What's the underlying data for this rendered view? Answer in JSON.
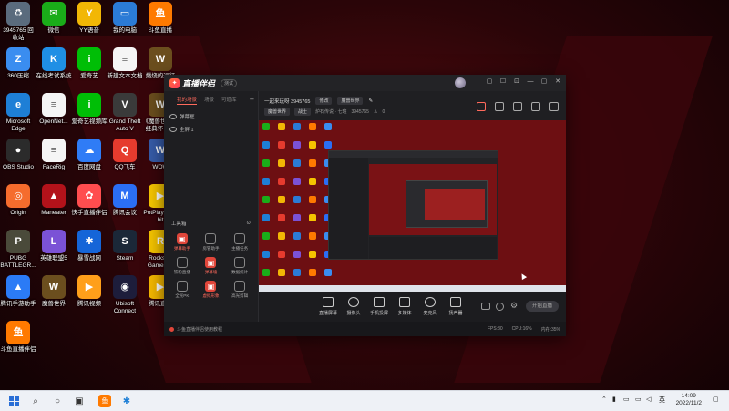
{
  "desktop": {
    "icons": [
      {
        "label": "3945765 回收站",
        "glyph": "♻",
        "color": "#5a6b7d"
      },
      {
        "label": "微信",
        "glyph": "✉",
        "color": "#1aad19"
      },
      {
        "label": "YY语音",
        "glyph": "Y",
        "color": "#f2b705"
      },
      {
        "label": "我的电脑",
        "glyph": "▭",
        "color": "#2b7bd6"
      },
      {
        "label": "斗鱼直播",
        "glyph": "鱼",
        "color": "#ff7a00"
      },
      {
        "label": "360压缩",
        "glyph": "Z",
        "color": "#3a8df0"
      },
      {
        "label": "在线考试系统",
        "glyph": "K",
        "color": "#1f8fe5"
      },
      {
        "label": "爱奇艺",
        "glyph": "i",
        "color": "#00be06"
      },
      {
        "label": "新建文本文档",
        "glyph": "≡",
        "color": "#f5f5f5"
      },
      {
        "label": "燃烧的远征",
        "glyph": "W",
        "color": "#6b4e1e"
      },
      {
        "label": "Microsoft Edge",
        "glyph": "e",
        "color": "#1e7fd6"
      },
      {
        "label": "OpenNet...",
        "glyph": "≡",
        "color": "#f5f5f5"
      },
      {
        "label": "爱奇艺视频库",
        "glyph": "i",
        "color": "#00be06"
      },
      {
        "label": "Grand Theft Auto V",
        "glyph": "V",
        "color": "#3a3a3a"
      },
      {
        "label": "《魔兽世界》经典怀旧服",
        "glyph": "W",
        "color": "#6b4e1e"
      },
      {
        "label": "OBS Studio",
        "glyph": "●",
        "color": "#2b2b2b"
      },
      {
        "label": "FaceRig",
        "glyph": "≡",
        "color": "#f5f5f5"
      },
      {
        "label": "百度网盘",
        "glyph": "☁",
        "color": "#2f7cf6"
      },
      {
        "label": "QQ飞车",
        "glyph": "Q",
        "color": "#e63b2e"
      },
      {
        "label": "WOW",
        "glyph": "W",
        "color": "#365ba8"
      },
      {
        "label": "Origin",
        "glyph": "◎",
        "color": "#f56c2d"
      },
      {
        "label": "Maneater",
        "glyph": "▲",
        "color": "#b3121a"
      },
      {
        "label": "快手直播伴侣",
        "glyph": "✿",
        "color": "#ff4d4f"
      },
      {
        "label": "腾讯会议",
        "glyph": "M",
        "color": "#2b6ef5"
      },
      {
        "label": "PotPlayer 64 bit",
        "glyph": "▶",
        "color": "#f7c600"
      },
      {
        "label": "PUBG BATTLEGR...",
        "glyph": "P",
        "color": "#4a4a3a"
      },
      {
        "label": "英雄联盟5",
        "glyph": "L",
        "color": "#7b52d6"
      },
      {
        "label": "暴雪战网",
        "glyph": "✱",
        "color": "#1565d8"
      },
      {
        "label": "Steam",
        "glyph": "S",
        "color": "#1b2838"
      },
      {
        "label": "Rockstar Games ...",
        "glyph": "R",
        "color": "#f5c400"
      },
      {
        "label": "腾讯手游助手",
        "glyph": "▲",
        "color": "#2b7bf6"
      },
      {
        "label": "魔兽世界",
        "glyph": "W",
        "color": "#6b4e1e"
      },
      {
        "label": "腾讯视频",
        "glyph": "▶",
        "color": "#ff9f1a"
      },
      {
        "label": "Ubisoft Connect",
        "glyph": "◉",
        "color": "#1d1d3b"
      },
      {
        "label": "腾讯直播",
        "glyph": "▶",
        "color": "#f5b800"
      },
      {
        "label": "斗鱼直播伴侣",
        "glyph": "鱼",
        "color": "#ff7a00"
      }
    ]
  },
  "app": {
    "name": "直播伴侣",
    "version": "测试",
    "window_buttons": [
      "▢",
      "☐",
      "⊡",
      "—",
      "▢",
      "✕"
    ],
    "left_tabs": [
      "我的场景",
      "场景",
      "可道库"
    ],
    "add_tab": "+",
    "layers": [
      "弹幕框",
      "全屏 1"
    ],
    "tools_header": "工具箱",
    "tools": [
      {
        "label": "弹幕助手",
        "hot": true,
        "style": "red"
      },
      {
        "label": "房管助手",
        "hot": false,
        "style": "grey"
      },
      {
        "label": "主播任务",
        "hot": false,
        "style": "grey"
      },
      {
        "label": "铁粉直播",
        "hot": false,
        "style": "grey"
      },
      {
        "label": "弹幕墙",
        "hot": true,
        "style": "red"
      },
      {
        "label": "数据统计",
        "hot": false,
        "style": "grey"
      },
      {
        "label": "全民PK",
        "hot": false,
        "style": "grey"
      },
      {
        "label": "虚拟形象",
        "hot": true,
        "style": "red"
      },
      {
        "label": "高光剪辑",
        "hot": false,
        "style": "grey"
      }
    ],
    "room": {
      "title": "一起来玩呀 3945765",
      "edit_label": "修改",
      "category": "魔兽世界",
      "row2": [
        "魔兽世界",
        "战士",
        "炉石传说 · 七班",
        "3945765",
        "0"
      ]
    },
    "bottom_buttons": [
      "直播屏幕",
      "摄像头",
      "手机投屏",
      "多媒体",
      "麦克风",
      "扬声器"
    ],
    "start_label": "开始直播",
    "status_left": "斗鱼直播伴侣使用教程",
    "status_right": [
      "FPS:30",
      "CPU:16%",
      "内存:35%"
    ]
  },
  "taskbar": {
    "time": "14:09",
    "date": "2022/11/2",
    "ime": "英",
    "start_icon": "windows-logo-icon",
    "colors": {
      "accent": "#ff6a5c",
      "brand": "#e0463a"
    }
  }
}
